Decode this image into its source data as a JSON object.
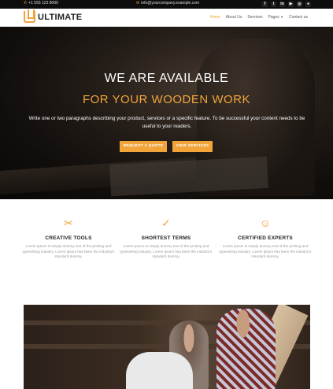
{
  "topbar": {
    "phone": "+1 555 123 8000",
    "email": "info@yourcompany.example.com",
    "socials": [
      {
        "icon": "facebook-icon",
        "glyph": "f"
      },
      {
        "icon": "twitter-icon",
        "glyph": "t"
      },
      {
        "icon": "linkedin-icon",
        "glyph": "in"
      },
      {
        "icon": "youtube-icon",
        "glyph": "▶"
      },
      {
        "icon": "instagram-icon",
        "glyph": "◎"
      },
      {
        "icon": "github-icon",
        "glyph": "●"
      }
    ]
  },
  "nav": {
    "logo": "ULTIMATE",
    "items": [
      "Home",
      "About Us",
      "Services",
      "Pages",
      "Contact us"
    ]
  },
  "hero": {
    "title": "WE ARE AVAILABLE",
    "subtitle": "FOR YOUR WOODEN WORK",
    "text": "Write one or two paragraphs describing your product, services or a specific feature. To be successful your content needs to be useful to your readers.",
    "btn_quote": "REQUEST A QUOTE",
    "btn_services": "VIEW SERVICES"
  },
  "features": [
    {
      "icon": "tools-icon",
      "glyph": "✂",
      "title": "CREATIVE TOOLS",
      "text": "Lorem Ipsum is simply dummy text of the printing and typesetting industry. Lorem Ipsum has been the industry's standard dummy."
    },
    {
      "icon": "check-circle-icon",
      "glyph": "✓",
      "title": "SHORTEST TERMS",
      "text": "Lorem Ipsum is simply dummy text of the printing and typesetting industry. Lorem Ipsum has been the industry's standard dummy."
    },
    {
      "icon": "experts-icon",
      "glyph": "☺",
      "title": "CERTIFIED EXPERTS",
      "text": "Lorem Ipsum is simply dummy text of the printing and typesetting industry. Lorem Ipsum has been the industry's standard dummy."
    }
  ],
  "colors": {
    "accent": "#f0a43a",
    "topbar": "#0d0d0d"
  }
}
